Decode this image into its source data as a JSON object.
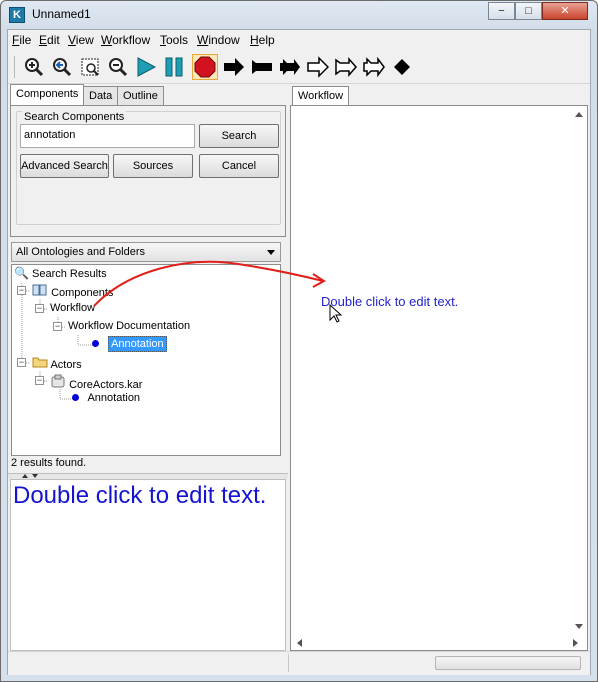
{
  "window": {
    "title": "Unnamed1",
    "app_icon_letter": "K"
  },
  "window_controls": {
    "minimize": "−",
    "maximize": "□",
    "close": "✕"
  },
  "menubar": [
    {
      "label": "File",
      "mnemonic": "F",
      "rest": "ile"
    },
    {
      "label": "Edit",
      "mnemonic": "E",
      "rest": "dit"
    },
    {
      "label": "View",
      "mnemonic": "V",
      "rest": "iew"
    },
    {
      "label": "Workflow",
      "mnemonic": "W",
      "rest": "orkflow"
    },
    {
      "label": "Tools",
      "mnemonic": "T",
      "rest": "ools"
    },
    {
      "label": "Window",
      "mnemonic": "W",
      "rest": "indow"
    },
    {
      "label": "Help",
      "mnemonic": "H",
      "rest": "elp"
    }
  ],
  "toolbar": {
    "icons": [
      "zoom-in-icon",
      "zoom-reset-icon",
      "zoom-fit-icon",
      "zoom-out-icon",
      "run-icon",
      "pause-icon",
      "stop-icon",
      "port-input-icon",
      "port-output-icon",
      "port-io-icon",
      "relation-icon",
      "relation-split-icon",
      "relation-merge-icon",
      "vertex-icon"
    ],
    "stop_color": "#d2121e",
    "run_color": "#1e9eb4"
  },
  "left_tabs": [
    "Components",
    "Data",
    "Outline"
  ],
  "search": {
    "legend": "Search Components",
    "query": "annotation",
    "search_button": "Search",
    "advanced_button": "Advanced Search",
    "sources_button": "Sources",
    "cancel_button": "Cancel"
  },
  "ontology_select": "All Ontologies and Folders",
  "tree": {
    "root": "Search Results",
    "components": "Components",
    "workflow": "Workflow",
    "workflow_doc": "Workflow Documentation",
    "annotation_selected": "Annotation",
    "actors": "Actors",
    "coreactors": "CoreActors.kar",
    "annotation": "Annotation"
  },
  "status_text": "2 results found.",
  "doc_preview_text": "Double click to edit text.",
  "right_tabs": [
    "Workflow"
  ],
  "canvas_annotation": "Double click to edit text.",
  "colors": {
    "accent": "#1414d2",
    "selection": "#3399ff",
    "drag_arrow": "#e0201a"
  }
}
